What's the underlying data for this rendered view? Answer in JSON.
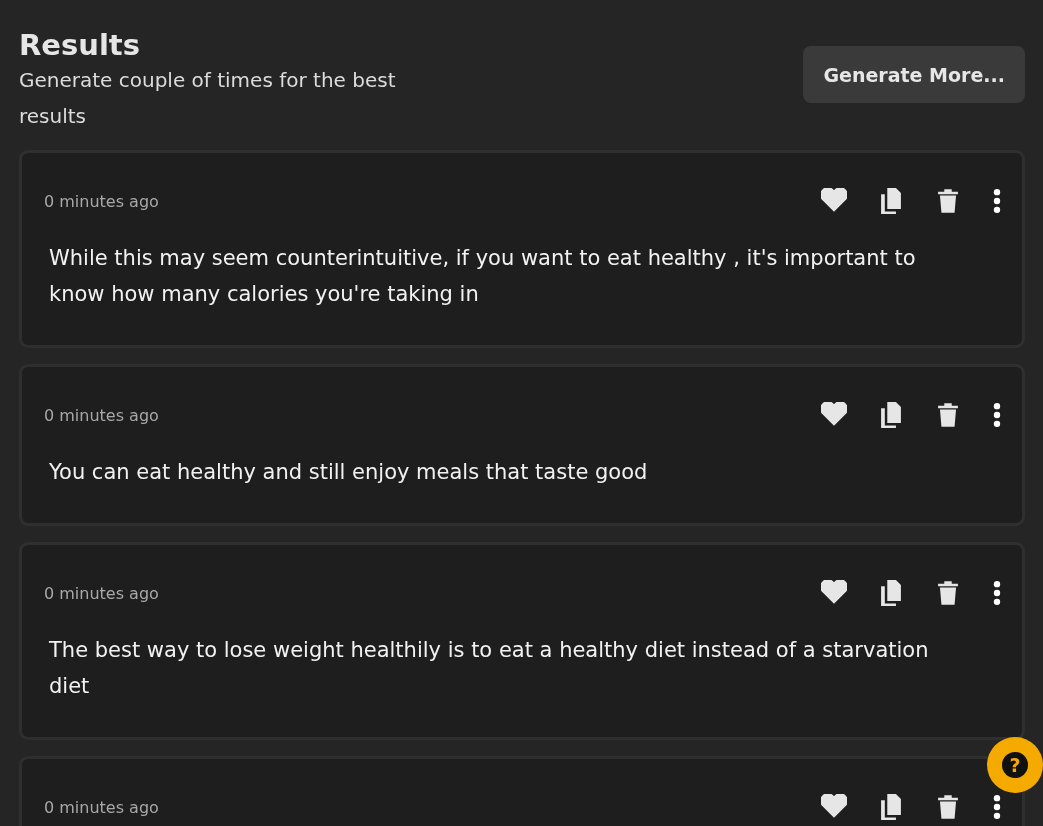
{
  "header": {
    "title": "Results",
    "subtitle": "Generate couple of times for the best results",
    "button": "Generate More..."
  },
  "results": [
    {
      "time": "0 minutes ago",
      "text": "While this may seem counterintuitive, if you want to eat healthy , it's important to know how many calories you're taking in"
    },
    {
      "time": "0 minutes ago",
      "text": "You can eat healthy and still enjoy meals that taste good"
    },
    {
      "time": "0 minutes ago",
      "text": "The best way to lose weight healthily is to eat a healthy diet instead of a starvation diet"
    },
    {
      "time": "0 minutes ago"
    }
  ],
  "help_button": "?"
}
